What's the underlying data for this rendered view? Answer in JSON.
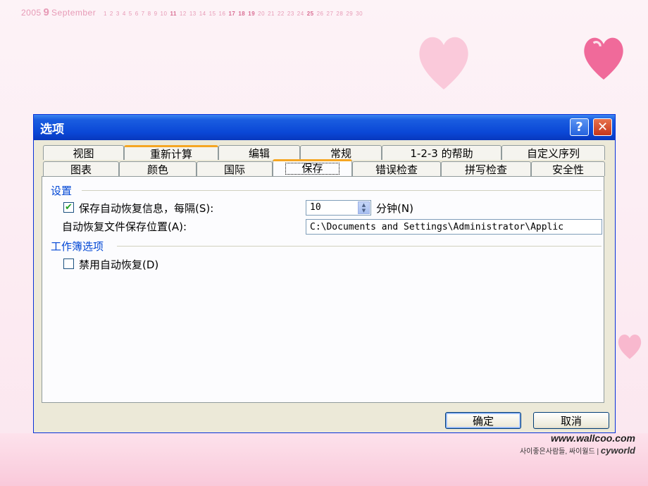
{
  "background": {
    "calendar": {
      "year": "2005",
      "day": "9",
      "month": "September",
      "days": [
        "1",
        "2",
        "3",
        "4",
        "5",
        "6",
        "7",
        "8",
        "9",
        "10",
        "11",
        "12",
        "13",
        "14",
        "15",
        "16",
        "17",
        "18",
        "19",
        "20",
        "21",
        "22",
        "23",
        "24",
        "25",
        "26",
        "27",
        "28",
        "29",
        "30"
      ],
      "bold_days": [
        "11",
        "17",
        "18",
        "19",
        "25"
      ]
    },
    "watermark": {
      "url": "www.wallcoo.com",
      "tagline": "사이좋은사람들, 싸이월드 | ",
      "brand": "cyworld"
    },
    "colors": {
      "accent_pink": "#f06a9a",
      "calendar_pink": "#e79ab6"
    }
  },
  "dialog": {
    "title": "选项",
    "help_icon": "help-icon",
    "close_icon": "close-icon",
    "tabs_row1": [
      "视图",
      "重新计算",
      "编辑",
      "常规",
      "1-2-3 的帮助",
      "自定义序列"
    ],
    "tabs_row2": [
      "图表",
      "颜色",
      "国际",
      "保存",
      "错误检查",
      "拼写检查",
      "安全性"
    ],
    "selected_tab": "保存",
    "settings": {
      "group_title": "设置",
      "autorecover_checkbox_label": "保存自动恢复信息，每隔(S):",
      "autorecover_checked": true,
      "interval_value": "10",
      "interval_unit_label": "分钟(N)",
      "location_label": "自动恢复文件保存位置(A):",
      "location_value": "C:\\Documents and Settings\\Administrator\\Applic"
    },
    "workbook": {
      "group_title": "工作簿选项",
      "disable_autorecover_label": "禁用自动恢复(D)",
      "disable_autorecover_checked": false
    },
    "buttons": {
      "ok": "确定",
      "cancel": "取消"
    },
    "colors": {
      "title_bar": "#0a47d6",
      "group_title": "#0046d5",
      "tab_highlight": "#f5a623",
      "face": "#ece9d8"
    }
  }
}
